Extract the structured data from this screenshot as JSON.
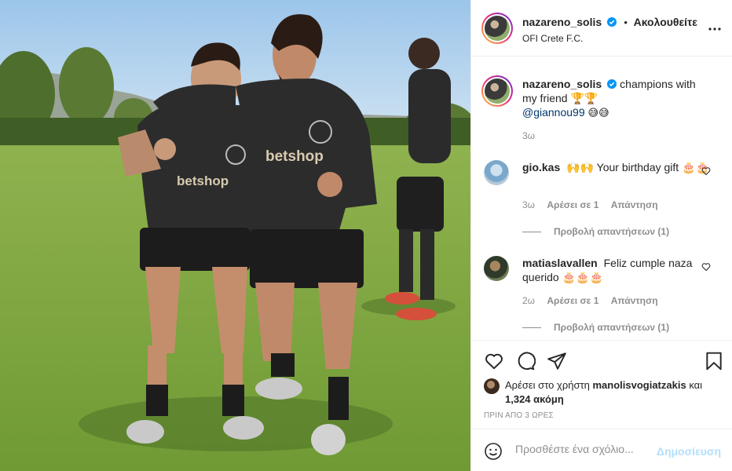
{
  "post": {
    "image_alt_icon": "photo-soccer-players",
    "author": "nazareno_solis",
    "follow_label": "Ακολουθείτε",
    "location": "OFI Crete F.C.",
    "caption": {
      "text": "champions with my friend 🏆🏆",
      "mention": "@giannou99",
      "tail_emojis": "😅😅",
      "time": "3ω"
    }
  },
  "comments": [
    {
      "user": "gio.kas",
      "text": "🙌🙌 Your birthday gift 🎂🎂",
      "time": "3ω",
      "likes": "Αρέσει σε 1",
      "reply": "Απάντηση",
      "view_replies": "Προβολή απαντήσεων (1)"
    },
    {
      "user": "matiaslavallen",
      "text": "Feliz cumple naza querido 🎂🎂🎂",
      "time": "2ω",
      "likes": "Αρέσει σε 1",
      "reply": "Απάντηση",
      "view_replies": "Προβολή απαντήσεων (1)"
    }
  ],
  "actions": {
    "icons": [
      "heart-icon",
      "comment-icon",
      "share-icon",
      "bookmark-icon"
    ]
  },
  "likes": {
    "prefix": "Αρέσει στο χρήστη",
    "user": "manolisvogiatzakis",
    "suffix": "και",
    "others": "1,324 ακόμη"
  },
  "posted_ago": "ΠΡΙΝ ΑΠΟ 3 ΩΡΕΣ",
  "add_comment": {
    "placeholder": "Προσθέστε ένα σχόλιο...",
    "post_label": "Δημοσίευση"
  },
  "colors": {
    "link": "#00376b",
    "muted": "#8e8e8e",
    "verified": "#0095f6",
    "post_disabled": "#b2dffc"
  }
}
